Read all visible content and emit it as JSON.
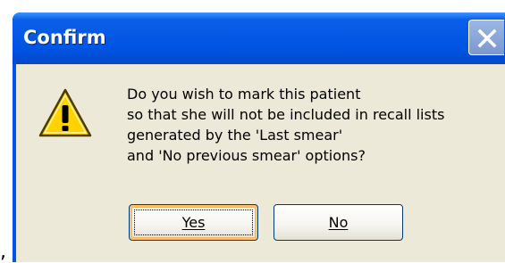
{
  "stray_mark": ",",
  "dialog": {
    "title": "Confirm",
    "close_icon": "close-icon",
    "icon": "warning-icon",
    "message_lines": [
      "Do you wish to mark this patient",
      "so that she will not be included in recall lists",
      "generated by the 'Last smear'",
      "and 'No previous smear' options?"
    ],
    "buttons": {
      "yes_label": "Yes",
      "no_label": "No"
    }
  },
  "colors": {
    "titlebar": "#0054e3",
    "client_background": "#ece9d8",
    "warning_fill": "#ffd200"
  }
}
